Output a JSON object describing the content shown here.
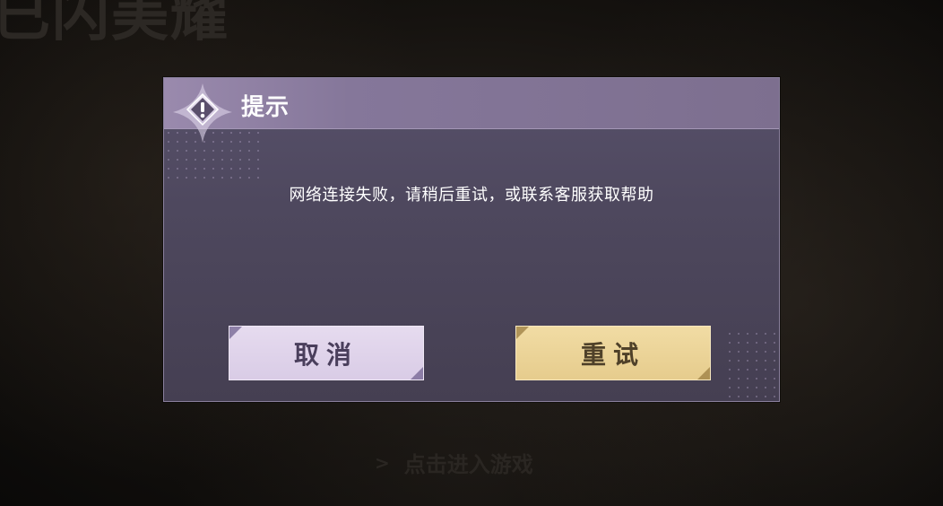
{
  "background": {
    "logo_text": "已闪美耀",
    "enter_game_arrow": ">",
    "enter_game_label": "点击进入游戏"
  },
  "dialog": {
    "title": "提示",
    "icon": "warning-emblem-icon",
    "message": "网络连接失败，请稍后重试，或联系客服获取帮助",
    "buttons": {
      "cancel_label": "取消",
      "retry_label": "重试"
    }
  },
  "colors": {
    "dialog_bg": "#4e485e",
    "header_bg": "#85779a",
    "cancel_bg": "#ddd1ea",
    "retry_bg": "#ecd596",
    "text_light": "#ffffff"
  }
}
